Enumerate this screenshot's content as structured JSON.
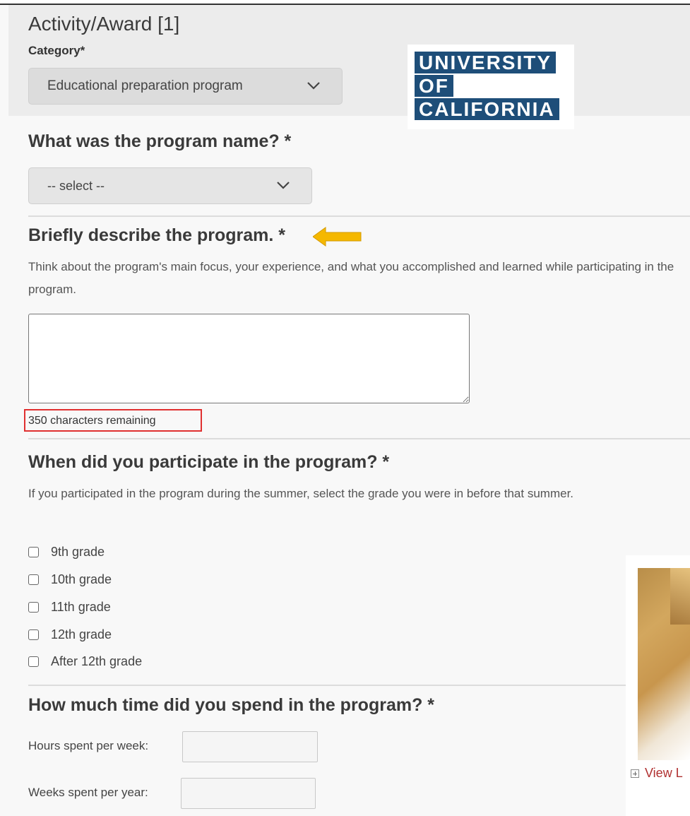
{
  "section": {
    "title": "Activity/Award [1]",
    "category_label": "Category*",
    "category_value": "Educational preparation program"
  },
  "logo": {
    "lines": [
      "UNIVERSITY",
      "OF",
      "CALIFORNIA"
    ],
    "color": "#1e4e79"
  },
  "program_name": {
    "question": "What was the program name? *",
    "select_value": "-- select --"
  },
  "describe": {
    "question": "Briefly describe the program. *",
    "help": "Think about the program's main focus, your experience, and what you accomplished and learned while participating in the program.",
    "textarea_value": "",
    "counter": "350 characters remaining",
    "arrow_color": "#f5b800"
  },
  "participation": {
    "question": "When did you participate in the program? *",
    "help": "If you participated in the program during the summer, select the grade you were in before that summer.",
    "options": [
      "9th grade",
      "10th grade",
      "11th grade",
      "12th grade",
      "After 12th grade"
    ]
  },
  "time_spent": {
    "question": "How much time did you spend in the program? *",
    "hours_label": "Hours spent per week:",
    "hours_value": "",
    "weeks_label": "Weeks spent per year:",
    "weeks_value": ""
  },
  "side_card": {
    "link_text": "View L"
  },
  "icons": {
    "select_chevron": "chevron-down-icon",
    "callout_arrow": "arrow-left-icon",
    "expand": "plus-box-icon"
  }
}
